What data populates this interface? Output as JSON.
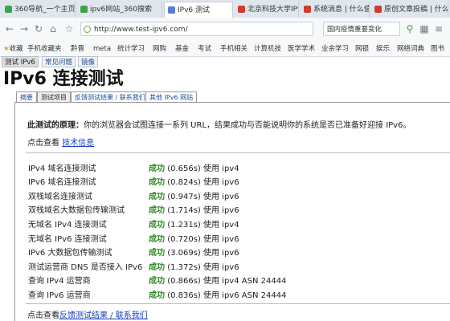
{
  "browser": {
    "tabs": [
      {
        "label": "360导航_一个主页",
        "color": "#3aa54a"
      },
      {
        "label": "ipv6网站_360搜索",
        "color": "#3aa54a"
      },
      {
        "label": "IPv6 测试",
        "color": "#5b7bd5"
      },
      {
        "label": "北京科技大学IPv6",
        "color": "#d23b2f"
      },
      {
        "label": "系统消息 | 什么值得",
        "color": "#d23b2f"
      },
      {
        "label": "原创文章投稿 | 什么",
        "color": "#d23b2f"
      }
    ],
    "url": "http://www.test-ipv6.com/",
    "search_text": "国内疫情重要变化",
    "bookmarks": [
      "收藏",
      "手机收藏夹",
      "黔晋",
      "meta",
      "统计学习",
      "网购",
      "基金",
      "考试",
      "手机相关",
      "计算机技",
      "医学学术",
      "业余学习",
      "网银",
      "娱乐",
      "网络词典",
      "图书"
    ]
  },
  "site": {
    "top_nav": [
      "测试 IPv6",
      "常见问题",
      "镜像"
    ],
    "title": "IPv6 连接测试",
    "sub_tabs": [
      "摘要",
      "测试项目",
      "反馈测试结果 / 联系我们",
      "其他 IPv6 网站"
    ],
    "principle_label": "此测试的原理：",
    "principle_text": "你的浏览器会试图连接一系列 URL，结果成功与否能说明你的系统是否已准备好迎接 IPv6。",
    "tech_prefix": "点击查看",
    "tech_link": "技术信息",
    "results": [
      {
        "name": "IPv4 域名连接测试",
        "status": "成功",
        "detail": "(0.656s) 使用 ipv4"
      },
      {
        "name": "IPv6 域名连接测试",
        "status": "成功",
        "detail": "(0.824s) 使用 ipv6"
      },
      {
        "name": "双栈域名连接测试",
        "status": "成功",
        "detail": "(0.947s) 使用 ipv6"
      },
      {
        "name": "双栈域名大数据包传输测试",
        "status": "成功",
        "detail": "(1.714s) 使用 ipv6"
      },
      {
        "name": "无域名 IPv4 连接测试",
        "status": "成功",
        "detail": "(1.231s) 使用 ipv4"
      },
      {
        "name": "无域名 IPv6 连接测试",
        "status": "成功",
        "detail": "(0.720s) 使用 ipv6"
      },
      {
        "name": "IPv6 大数据包传输测试",
        "status": "成功",
        "detail": "(3.069s) 使用 ipv6"
      },
      {
        "name": "测试运营商 DNS 是否接入 IPv6",
        "status": "成功",
        "detail": "(1.372s) 使用 ipv6"
      },
      {
        "name": "查询 IPv4 运营商",
        "status": "成功",
        "detail": "(0.866s) 使用 ipv4 ASN 24444"
      },
      {
        "name": "查询 IPv6 运营商",
        "status": "成功",
        "detail": "(0.836s) 使用 ipv6 ASN 24444"
      }
    ],
    "feedback_prefix": "点击查看",
    "feedback_link": "反馈测试结果 / 联系我们"
  }
}
